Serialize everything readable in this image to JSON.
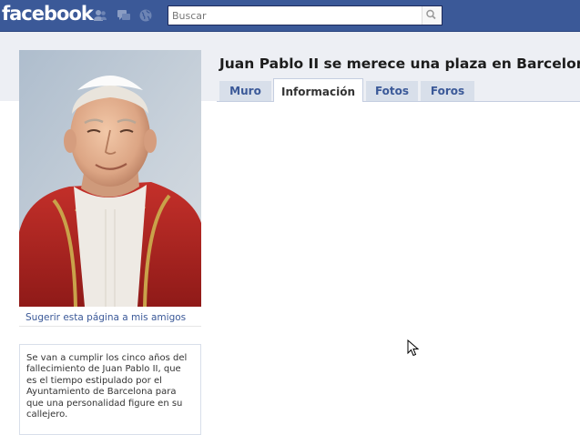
{
  "header": {
    "logo_text": "facebook",
    "icons": [
      "friend-requests-icon",
      "messages-icon",
      "notifications-icon"
    ],
    "search": {
      "placeholder": "Buscar",
      "icon": "search-icon"
    },
    "colors": {
      "bar": "#3b5998",
      "subbar": "#edeff4"
    }
  },
  "sidebar": {
    "profile_image": "photo-of-pope-in-white-zucchetto-and-red-mozzetta",
    "suggest_link": "Sugerir esta página a mis amigos",
    "info_text": "Se van a cumplir los cinco años del fallecimiento de Juan Pablo II, que es el tiempo estipulado por el Ayuntamiento de Barcelona para que una personalidad figure en su callejero."
  },
  "main": {
    "title": "Juan Pablo II se merece una plaza en Barcelona",
    "tabs": [
      {
        "label": "Muro",
        "active": false
      },
      {
        "label": "Información",
        "active": true
      },
      {
        "label": "Fotos",
        "active": false
      },
      {
        "label": "Foros",
        "active": false
      }
    ]
  },
  "cursor": "arrow-cursor"
}
